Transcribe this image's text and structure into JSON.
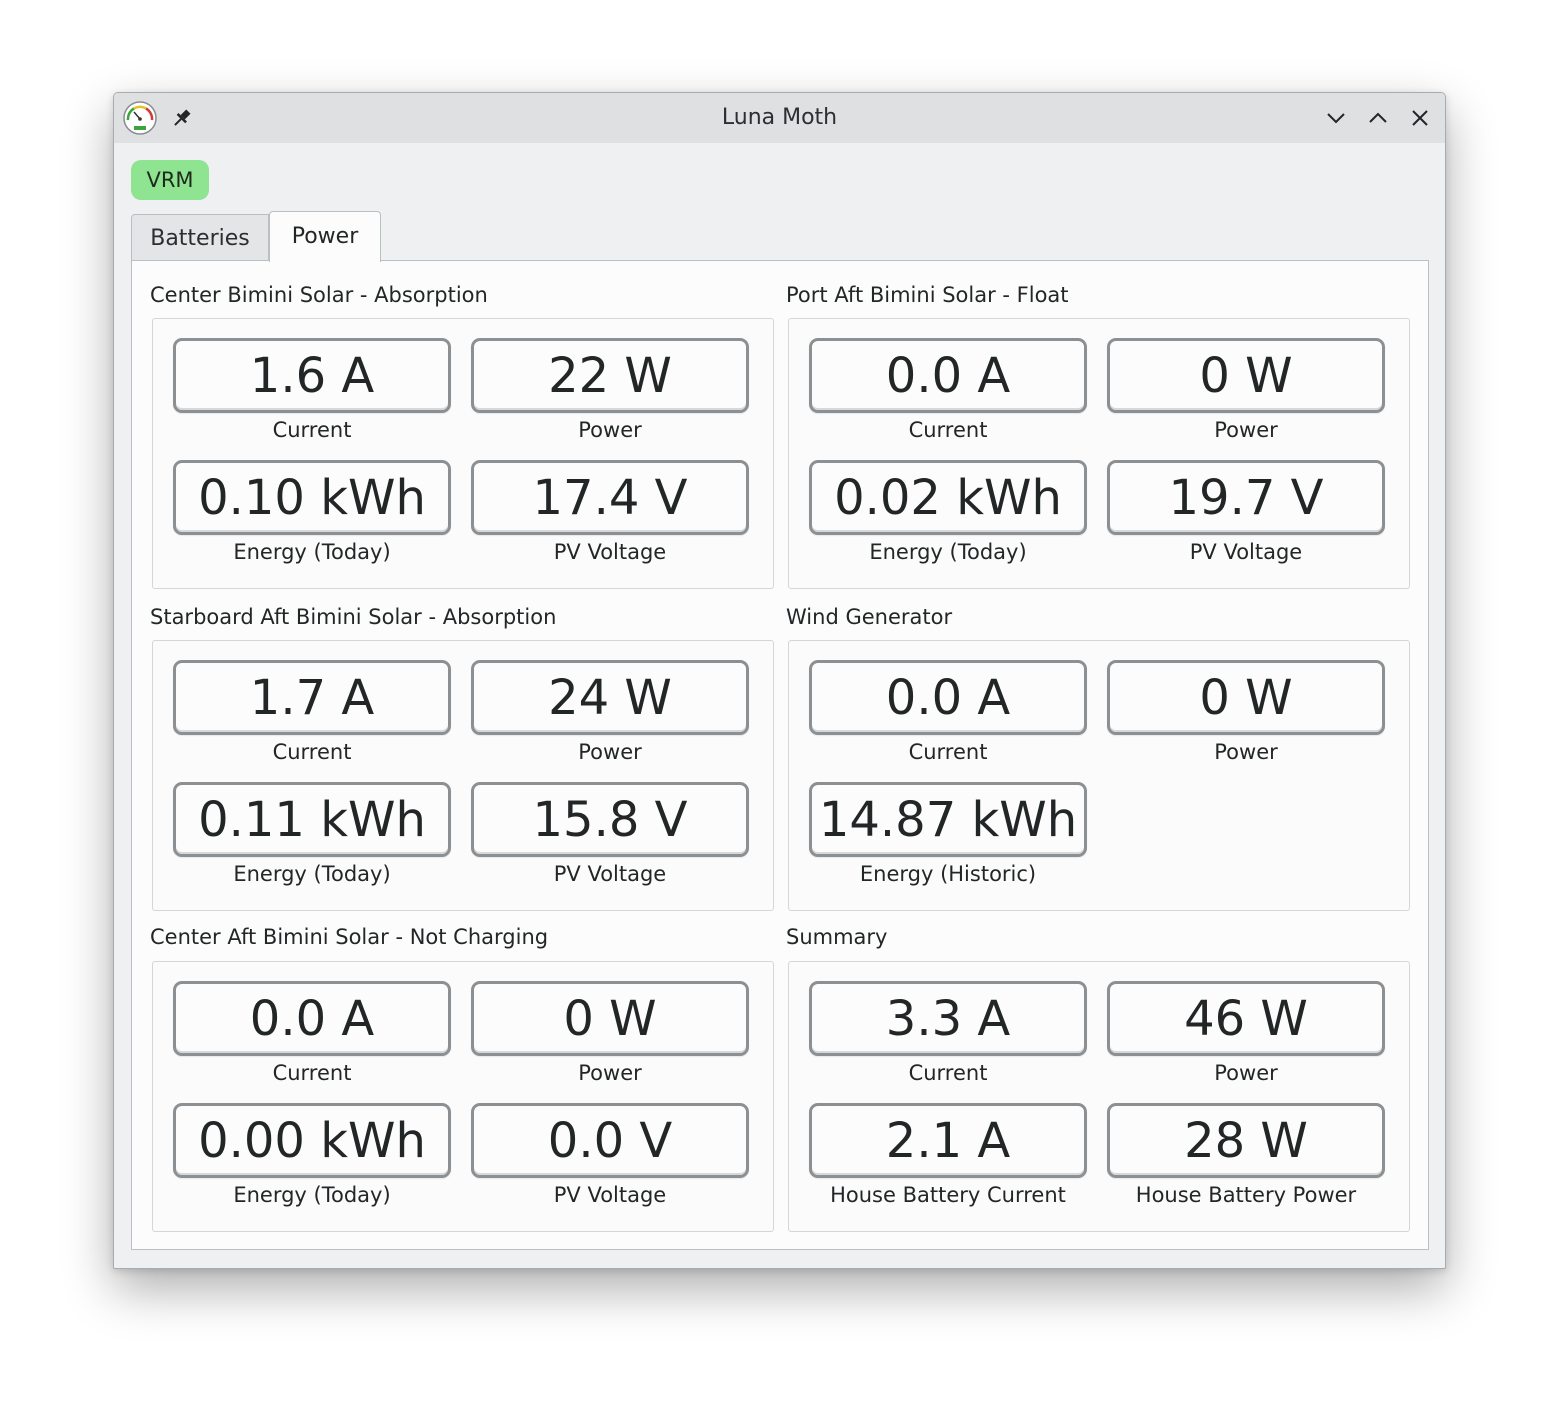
{
  "window": {
    "title": "Luna Moth"
  },
  "icons": {
    "app": "gauge-icon",
    "pin": "pin-icon",
    "minimize": "chevron-down-icon",
    "maximize": "chevron-up-icon",
    "close": "close-icon"
  },
  "colors": {
    "vrm_button": "#8ee490",
    "window_bg": "#eff0f1",
    "panel_bg": "#fcfcfc",
    "value_border": "#8c9093"
  },
  "toolbar": {
    "vrm_label": "VRM"
  },
  "tabs": [
    {
      "label": "Batteries",
      "selected": false
    },
    {
      "label": "Power",
      "selected": true
    }
  ],
  "groups": [
    {
      "title": "Center Bimini Solar - Absorption",
      "metrics": [
        {
          "value": "1.6 A",
          "label": "Current"
        },
        {
          "value": "22 W",
          "label": "Power"
        },
        {
          "value": "0.10 kWh",
          "label": "Energy (Today)"
        },
        {
          "value": "17.4 V",
          "label": "PV Voltage"
        }
      ]
    },
    {
      "title": "Port Aft Bimini Solar - Float",
      "metrics": [
        {
          "value": "0.0 A",
          "label": "Current"
        },
        {
          "value": "0 W",
          "label": "Power"
        },
        {
          "value": "0.02 kWh",
          "label": "Energy (Today)"
        },
        {
          "value": "19.7 V",
          "label": "PV Voltage"
        }
      ]
    },
    {
      "title": "Starboard Aft Bimini Solar - Absorption",
      "metrics": [
        {
          "value": "1.7 A",
          "label": "Current"
        },
        {
          "value": "24 W",
          "label": "Power"
        },
        {
          "value": "0.11 kWh",
          "label": "Energy (Today)"
        },
        {
          "value": "15.8 V",
          "label": "PV Voltage"
        }
      ]
    },
    {
      "title": "Wind Generator",
      "metrics": [
        {
          "value": "0.0 A",
          "label": "Current"
        },
        {
          "value": "0 W",
          "label": "Power"
        },
        {
          "value": "14.87 kWh",
          "label": "Energy (Historic)"
        }
      ]
    },
    {
      "title": "Center Aft Bimini Solar - Not Charging",
      "metrics": [
        {
          "value": "0.0 A",
          "label": "Current"
        },
        {
          "value": "0 W",
          "label": "Power"
        },
        {
          "value": "0.00 kWh",
          "label": "Energy (Today)"
        },
        {
          "value": "0.0 V",
          "label": "PV Voltage"
        }
      ]
    },
    {
      "title": "Summary",
      "metrics": [
        {
          "value": "3.3 A",
          "label": "Current"
        },
        {
          "value": "46 W",
          "label": "Power"
        },
        {
          "value": "2.1 A",
          "label": "House Battery Current"
        },
        {
          "value": "28 W",
          "label": "House Battery Power"
        }
      ]
    }
  ]
}
